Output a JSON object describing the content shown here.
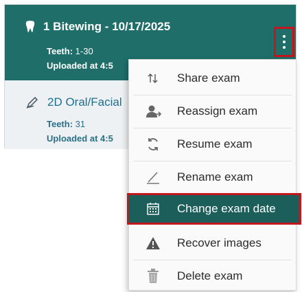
{
  "exams": [
    {
      "title": "1 Bitewing - 10/17/2025",
      "teeth_label": "Teeth:",
      "teeth_value": "1-30",
      "uploaded_label": "Uploaded at",
      "uploaded_value": "4:5",
      "icon": "tooth-icon"
    },
    {
      "title": "2D Oral/Facial",
      "teeth_label": "Teeth:",
      "teeth_value": "31",
      "uploaded_label": "Uploaded at",
      "uploaded_value": "4:5",
      "icon": "pen-icon"
    }
  ],
  "menu": {
    "items": [
      {
        "label": "Share exam",
        "icon": "share-arrows-icon"
      },
      {
        "label": "Reassign exam",
        "icon": "reassign-user-icon"
      },
      {
        "label": "Resume exam",
        "icon": "resume-cycle-icon"
      },
      {
        "label": "Rename exam",
        "icon": "pencil-icon"
      },
      {
        "label": "Change exam date",
        "icon": "calendar-icon"
      },
      {
        "label": "Recover images",
        "icon": "warning-icon"
      },
      {
        "label": "Delete exam",
        "icon": "trash-icon"
      }
    ]
  },
  "colors": {
    "selected_bg": "#1f6e6a",
    "highlight_border": "#c4161c",
    "active_item_bg": "#1b5e5a"
  }
}
